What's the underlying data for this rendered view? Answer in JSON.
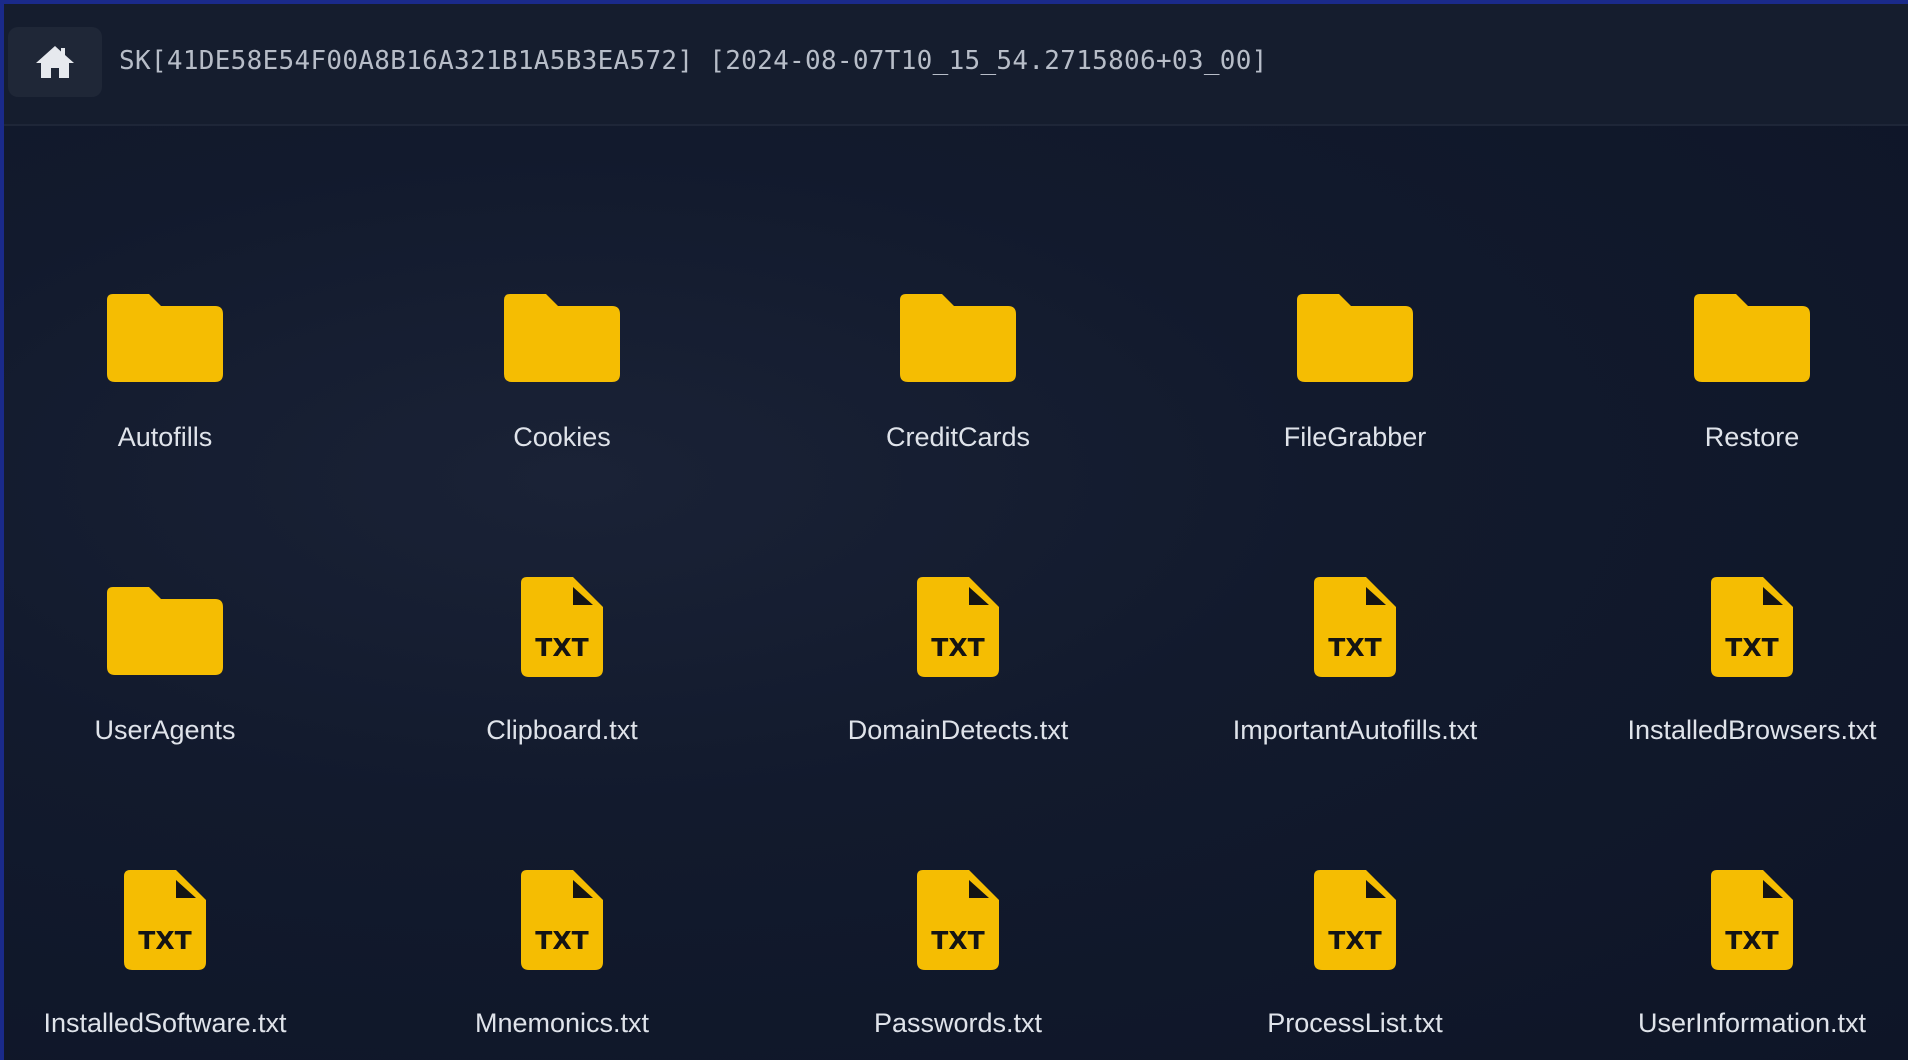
{
  "header": {
    "path": "SK[41DE58E54F00A8B16A321B1A5B3EA572] [2024-08-07T10_15_54.2715806+03_00]",
    "home_icon": "home-icon"
  },
  "colors": {
    "accent": "#f5bd02",
    "background": "#0d1427",
    "topbar": "#151d2e"
  },
  "items": [
    {
      "name": "Autofills",
      "type": "folder",
      "icon": "folder-icon"
    },
    {
      "name": "Cookies",
      "type": "folder",
      "icon": "folder-icon"
    },
    {
      "name": "CreditCards",
      "type": "folder",
      "icon": "folder-icon"
    },
    {
      "name": "FileGrabber",
      "type": "folder",
      "icon": "folder-icon"
    },
    {
      "name": "Restore",
      "type": "folder",
      "icon": "folder-icon"
    },
    {
      "name": "UserAgents",
      "type": "folder",
      "icon": "folder-icon"
    },
    {
      "name": "Clipboard.txt",
      "type": "txt",
      "icon": "txt-file-icon",
      "badge": "TXT"
    },
    {
      "name": "DomainDetects.txt",
      "type": "txt",
      "icon": "txt-file-icon",
      "badge": "TXT"
    },
    {
      "name": "ImportantAutofills.txt",
      "type": "txt",
      "icon": "txt-file-icon",
      "badge": "TXT"
    },
    {
      "name": "InstalledBrowsers.txt",
      "type": "txt",
      "icon": "txt-file-icon",
      "badge": "TXT"
    },
    {
      "name": "InstalledSoftware.txt",
      "type": "txt",
      "icon": "txt-file-icon",
      "badge": "TXT"
    },
    {
      "name": "Mnemonics.txt",
      "type": "txt",
      "icon": "txt-file-icon",
      "badge": "TXT"
    },
    {
      "name": "Passwords.txt",
      "type": "txt",
      "icon": "txt-file-icon",
      "badge": "TXT"
    },
    {
      "name": "ProcessList.txt",
      "type": "txt",
      "icon": "txt-file-icon",
      "badge": "TXT"
    },
    {
      "name": "UserInformation.txt",
      "type": "txt",
      "icon": "txt-file-icon",
      "badge": "TXT"
    }
  ]
}
